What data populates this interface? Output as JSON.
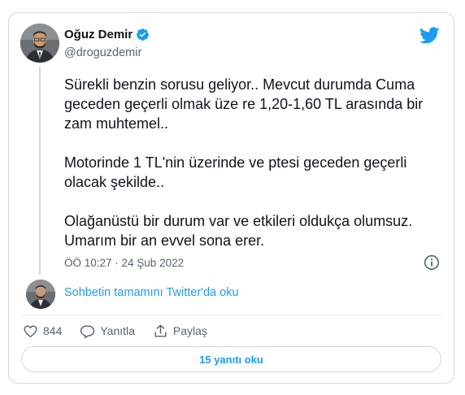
{
  "author": {
    "display_name": "Oğuz Demir",
    "handle": "@droguzdemir",
    "verified": true
  },
  "tweet": {
    "text": "Sürekli benzin sorusu geliyor.. Mevcut durumda Cuma geceden geçerli olmak üze re 1,20-1,60 TL arasında bir zam muhtemel..\n\nMotorinde 1 TL'nin üzerinde ve ptesi geceden geçerli olacak şekilde..\n\nOlağanüstü bir durum var ve etkileri oldukça olumsuz. Umarım bir an evvel sona erer.",
    "timestamp": "ÖÖ 10:27 · 24 Şub 2022"
  },
  "thread_link_label": "Sohbetin tamamını Twitter'da oku",
  "actions": {
    "like_count": "844",
    "reply_label": "Yanıtla",
    "share_label": "Paylaş"
  },
  "replies_button_label": "15 yanıtı oku",
  "colors": {
    "accent": "#1d9bf0",
    "text": "#0f1419",
    "secondary": "#536471",
    "border": "#cfd9de"
  },
  "icons": [
    "verified-badge-icon",
    "twitter-bird-icon",
    "info-icon",
    "heart-icon",
    "reply-icon",
    "share-icon"
  ]
}
